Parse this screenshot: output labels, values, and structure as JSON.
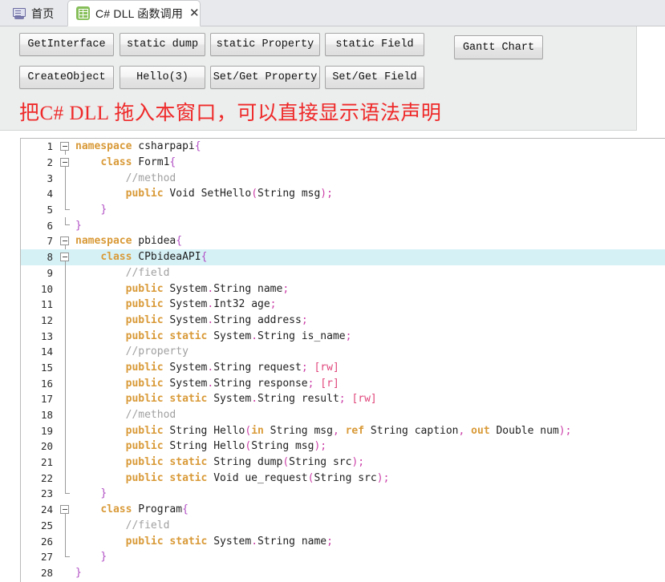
{
  "tabs": {
    "home": {
      "label": "首页",
      "icon": "monitor-icon"
    },
    "active": {
      "label": "C# DLL 函数调用",
      "icon": "green-grid-icon",
      "close": "✕"
    }
  },
  "toolbar": {
    "row1": [
      "GetInterface",
      "static dump",
      "static Property",
      "static Field"
    ],
    "row2": [
      "CreateObject",
      "Hello(3)",
      "Set/Get Property",
      "Set/Get Field"
    ],
    "gantt": "Gantt Chart"
  },
  "hint": "把C# DLL 拖入本窗口，可以直接显示语法声明",
  "colors": {
    "hint_red": "#ef2929",
    "keyword": "#d99a38",
    "punctuation": "#cc3fa8",
    "comment": "#a0a0a0",
    "brace": "#b14fc4",
    "bracket": "#e0457b",
    "current_line": "#d6f1f6",
    "tab_icon_green": "#86bf5a",
    "toolbar_bg": "#eceded"
  },
  "code": {
    "lines": [
      {
        "n": "1",
        "fold": "box",
        "text": "namespace csharpapi{"
      },
      {
        "n": "2",
        "fold": "box-line",
        "text": "    class Form1{"
      },
      {
        "n": "3",
        "fold": "line",
        "text": "        //method"
      },
      {
        "n": "4",
        "fold": "line",
        "text": "        public Void SetHello(String msg);"
      },
      {
        "n": "5",
        "fold": "tick",
        "text": "    }"
      },
      {
        "n": "6",
        "fold": "end",
        "text": "}"
      },
      {
        "n": "7",
        "fold": "box",
        "text": "namespace pbidea{"
      },
      {
        "n": "8",
        "fold": "box-line",
        "text": "    class CPbideaAPI{",
        "highlight": true
      },
      {
        "n": "9",
        "fold": "line",
        "text": "        //field"
      },
      {
        "n": "10",
        "fold": "line",
        "text": "        public System.String name;"
      },
      {
        "n": "11",
        "fold": "line",
        "text": "        public System.Int32 age;"
      },
      {
        "n": "12",
        "fold": "line",
        "text": "        public System.String address;"
      },
      {
        "n": "13",
        "fold": "line",
        "text": "        public static System.String is_name;"
      },
      {
        "n": "14",
        "fold": "line",
        "text": "        //property"
      },
      {
        "n": "15",
        "fold": "line",
        "text": "        public System.String request; [rw]"
      },
      {
        "n": "16",
        "fold": "line",
        "text": "        public System.String response; [r]"
      },
      {
        "n": "17",
        "fold": "line",
        "text": "        public static System.String result; [rw]"
      },
      {
        "n": "18",
        "fold": "line",
        "text": "        //method"
      },
      {
        "n": "19",
        "fold": "line",
        "text": "        public String Hello(in String msg, ref String caption, out Double num);"
      },
      {
        "n": "20",
        "fold": "line",
        "text": "        public String Hello(String msg);"
      },
      {
        "n": "21",
        "fold": "line",
        "text": "        public static String dump(String src);"
      },
      {
        "n": "22",
        "fold": "line",
        "text": "        public static Void ue_request(String src);"
      },
      {
        "n": "23",
        "fold": "tick",
        "text": "    }"
      },
      {
        "n": "24",
        "fold": "box-line",
        "text": "    class Program{"
      },
      {
        "n": "25",
        "fold": "line",
        "text": "        //field"
      },
      {
        "n": "26",
        "fold": "line",
        "text": "        public static System.String name;"
      },
      {
        "n": "27",
        "fold": "tick",
        "text": "    }"
      },
      {
        "n": "28",
        "fold": "none",
        "text": "}"
      }
    ]
  }
}
